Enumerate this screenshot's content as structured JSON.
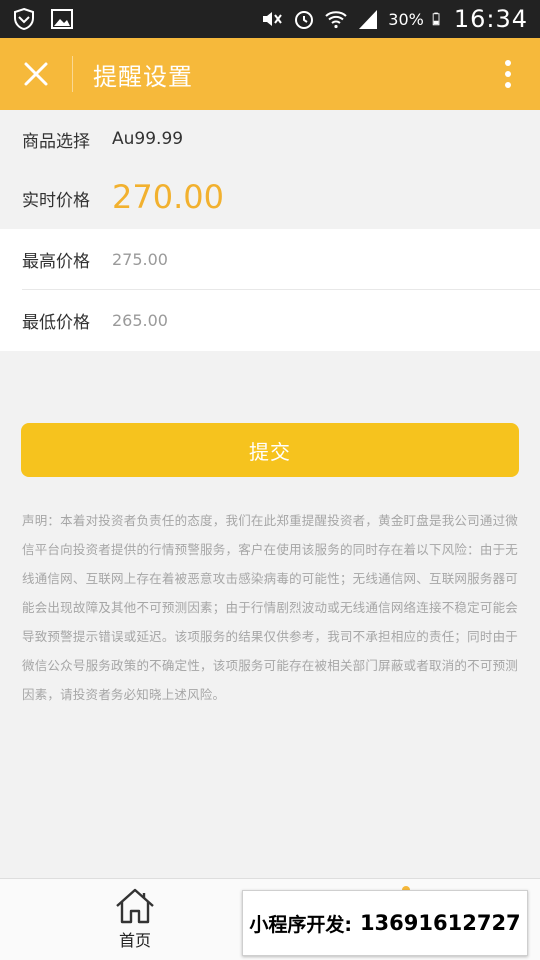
{
  "status_bar": {
    "battery": "30%",
    "time": "16:34"
  },
  "header": {
    "title": "提醒设置",
    "close_icon": "close-icon",
    "more_icon": "more-vertical-icon"
  },
  "info": {
    "product_label": "商品选择",
    "product_value": "Au99.99",
    "live_price_label": "实时价格",
    "live_price_value": "270.00"
  },
  "form": {
    "max_price_label": "最高价格",
    "max_price_placeholder": "275.00",
    "min_price_label": "最低价格",
    "min_price_placeholder": "265.00"
  },
  "submit_label": "提交",
  "disclaimer": "声明：本着对投资者负责任的态度，我们在此郑重提醒投资者，黄金盯盘是我公司通过微信平台向投资者提供的行情预警服务，客户在使用该服务的同时存在着以下风险：由于无线通信网、互联网上存在着被恶意攻击感染病毒的可能性；无线通信网、互联网服务器可能会出现故障及其他不可预测因素；由于行情剧烈波动或无线通信网络连接不稳定可能会导致预警提示错误或延迟。该项服务的结果仅供参考，我司不承担相应的责任；同时由于微信公众号服务政策的不确定性，该项服务可能存在被相关部门屏蔽或者取消的不可预测因素，请投资者务必知晓上述风险。",
  "tab_bar": {
    "home_label": "首页"
  },
  "overlay": {
    "label": "小程序开发:",
    "phone": "13691612727"
  },
  "colors": {
    "accent": "#f6b93b",
    "button": "#f6c31e",
    "price": "#f2b12f"
  }
}
